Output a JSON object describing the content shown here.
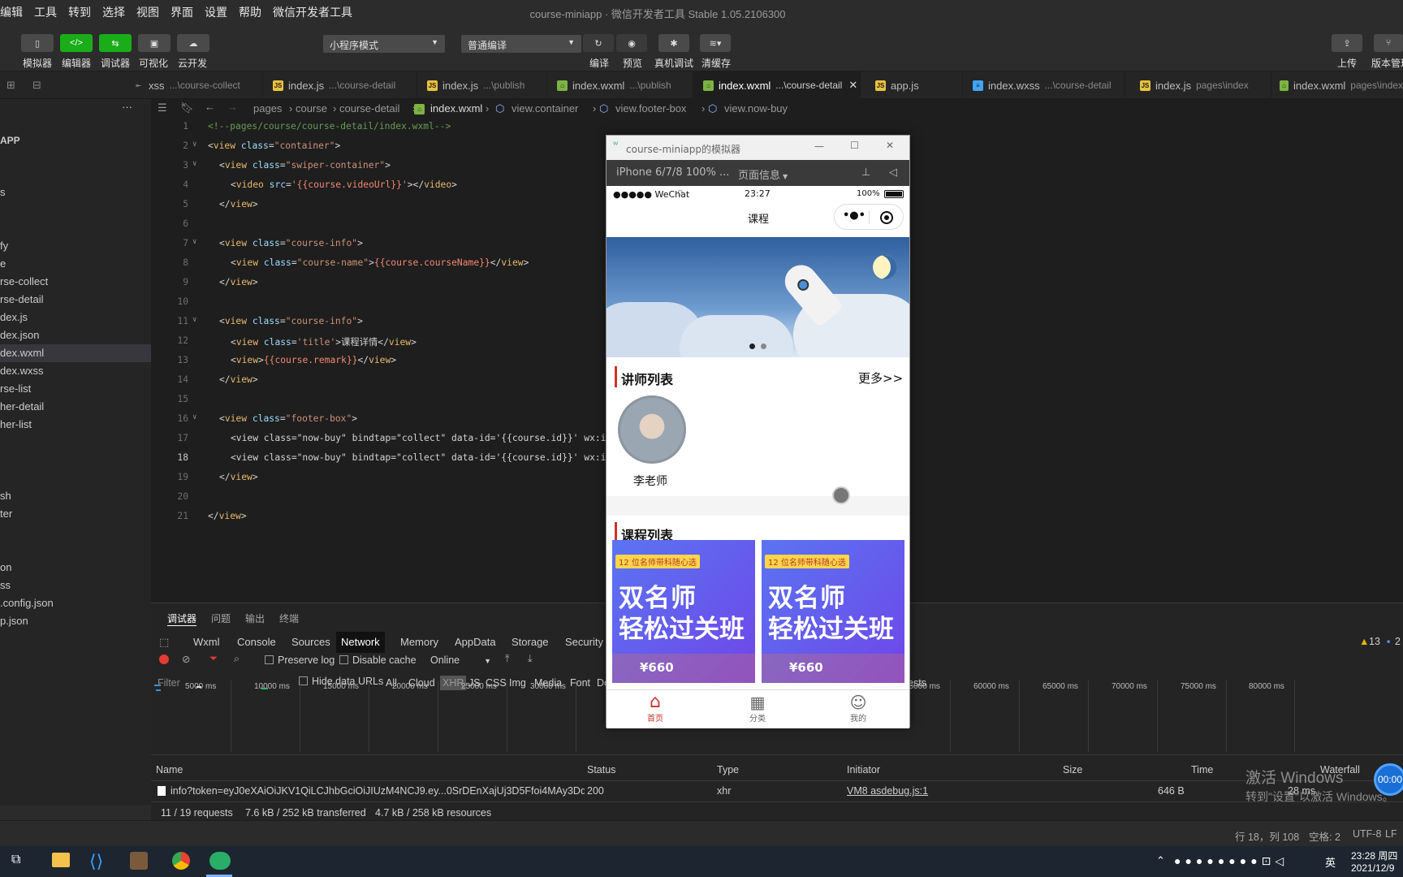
{
  "menubar": {
    "items": [
      "编辑",
      "工具",
      "转到",
      "选择",
      "视图",
      "界面",
      "设置",
      "帮助",
      "微信开发者工具"
    ]
  },
  "window": {
    "title": "course-miniapp · 微信开发者工具 Stable 1.05.2106300"
  },
  "toolbar": {
    "simulator": "模拟器",
    "editor": "编辑器",
    "debugger": "调试器",
    "visual": "可视化",
    "cloud": "云开发",
    "mode_select": "小程序模式",
    "compile_select": "普通编译",
    "compile": "编译",
    "preview": "预览",
    "real_debug": "真机调试",
    "clear_cache": "清缓存",
    "upload": "上传",
    "version": "版本管理"
  },
  "tabs": [
    {
      "name": "xss",
      "hint": "...\\course-collect",
      "type": "css"
    },
    {
      "name": "index.js",
      "hint": "...\\course-detail",
      "type": "js"
    },
    {
      "name": "index.js",
      "hint": "...\\publish",
      "type": "js"
    },
    {
      "name": "index.wxml",
      "hint": "...\\publish",
      "type": "wxml"
    },
    {
      "name": "index.wxml",
      "hint": "...\\course-detail",
      "type": "wxml"
    },
    {
      "name": "app.js",
      "hint": "",
      "type": "js"
    },
    {
      "name": "index.wxss",
      "hint": "...\\course-detail",
      "type": "css"
    },
    {
      "name": "index.js",
      "hint": "pages\\index",
      "type": "js"
    },
    {
      "name": "index.wxml",
      "hint": "pages\\index",
      "type": "wxml"
    }
  ],
  "sidebar": {
    "root": "APP",
    "items": [
      "s",
      "",
      "fy",
      "e",
      "rse-collect",
      "rse-detail",
      "dex.js",
      "dex.json",
      "dex.wxml",
      "dex.wxss",
      "rse-list",
      "her-detail",
      "her-list",
      "",
      "",
      "",
      "sh",
      "ter",
      "",
      "",
      "on",
      "ss",
      ".config.json",
      "p.json"
    ]
  },
  "breadcrumb": [
    "pages",
    "course",
    "course-detail",
    "index.wxml",
    "view.container",
    "view.footer-box",
    "view.now-buy"
  ],
  "code": {
    "line1": "<!--pages/course/course-detail/index.wxml-->",
    "l17": "<view class=\"now-buy\" bindtap=\"collect\" data-id='{{course.id}}' wx:if=",
    "l18": "<view class=\"now-buy\" bindtap=\"collect\" data-id='{{course.id}}' wx:if="
  },
  "panel": {
    "tabs": [
      "调试器",
      "问题",
      "输出",
      "终端"
    ],
    "devtabs": [
      "Wxml",
      "Console",
      "Sources",
      "Network",
      "Memory",
      "AppData",
      "Storage",
      "Security"
    ],
    "warn_count": "13",
    "info_count": "2",
    "preserve_log": "Preserve log",
    "disable_cache": "Disable cache",
    "throttle": "Online",
    "filter_placeholder": "Filter",
    "hide_data_urls": "Hide data URLs",
    "types": [
      "All",
      "Cloud",
      "XHR",
      "JS",
      "CSS",
      "Img",
      "Media",
      "Font",
      "Do"
    ],
    "ticks_left": [
      "5000 ms",
      "10000 ms",
      "15000 ms",
      "20000 ms",
      "25000 ms",
      "30000 ms"
    ],
    "ticks_right": [
      "55000 ms",
      "60000 ms",
      "65000 ms",
      "70000 ms",
      "75000 ms",
      "80000 ms"
    ],
    "ests": "ests",
    "columns": [
      "Name",
      "Status",
      "Type",
      "Initiator",
      "Size",
      "Time",
      "Waterfall"
    ],
    "row": {
      "name": "info?token=eyJ0eXAiOiJKV1QiLCJhbGciOiJIUzM4NCJ9.ey...0SrDEnXajUj3D5Ffoi4MAy3Dq7g4n...",
      "status": "200",
      "type": "xhr",
      "initiator": "VM8 asdebug.js:1",
      "size": "646 B",
      "time": "28 ms"
    },
    "summary": [
      "11 / 19 requests",
      "7.6 kB / 252 kB transferred",
      "4.7 kB / 258 kB resources"
    ]
  },
  "statusbar": {
    "position": "行 18，列 108",
    "spaces": "空格: 2",
    "encoding": "UTF-8",
    "eol": "LF"
  },
  "watermark": {
    "line1": "激活 Windows",
    "line2": "转到\"设置\"以激活 Windows。"
  },
  "taskbar": {
    "time": "23:28 周四",
    "date": "2021/12/9",
    "ime": "英",
    "clock_badge": "00:00"
  },
  "simulator": {
    "title": "course-miniapp的模拟器",
    "device": "iPhone 6/7/8 100% ...",
    "page_info": "页面信息",
    "status_carrier": "●●●●● WeChat",
    "status_time": "23:27",
    "status_battery": "100%",
    "nav_title": "课程",
    "teacher_section": "讲师列表",
    "more": "更多>>",
    "teacher_name": "李老师",
    "course_section": "课程列表",
    "card_badge": "12 位名师带科随心选",
    "card_line1": "双名师",
    "card_line2": "轻松过关班",
    "card_price": "¥660",
    "tabbar": [
      "首页",
      "分类",
      "我的"
    ]
  }
}
